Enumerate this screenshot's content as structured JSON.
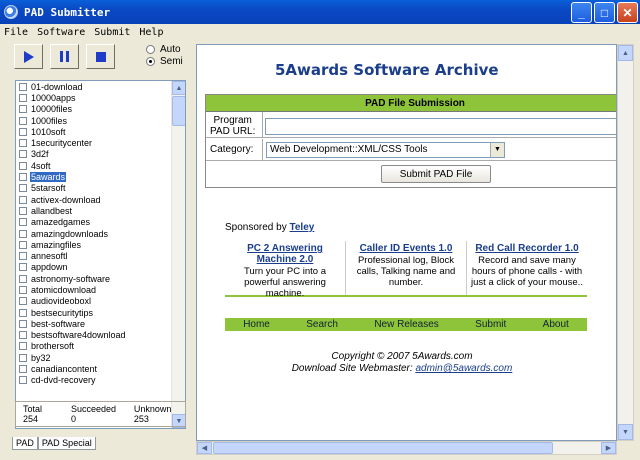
{
  "window": {
    "title": "PAD Submitter"
  },
  "menu": [
    "File",
    "Software",
    "Submit",
    "Help"
  ],
  "mode": {
    "auto_label": "Auto",
    "semi_label": "Semi",
    "selected": "Semi"
  },
  "sites": [
    "01-download",
    "10000apps",
    "10000files",
    "1000files",
    "1010soft",
    "1securitycenter",
    "3d2f",
    "4soft",
    "5awards",
    "5starsoft",
    "activex-download",
    "allandbest",
    "amazedgames",
    "amazingdownloads",
    "amazingfiles",
    "annesoftl",
    "appdown",
    "astronomy-software",
    "atomicdownload",
    "audiovideoboxl",
    "bestsecuritytips",
    "best-software",
    "bestsoftware4download",
    "brothersoft",
    "by32",
    "canadiancontent",
    "cd-dvd-recovery"
  ],
  "selected_site": "5awards",
  "status": {
    "total": "Total  254",
    "succeeded": "Succeeded  0",
    "unknown": "Unknown  253"
  },
  "tabs": [
    "PAD",
    "PAD Special"
  ],
  "web": {
    "site_title": "5Awards Software Archive",
    "form_header": "PAD File Submission",
    "url_label_1": "Program",
    "url_label_2": "PAD URL:",
    "url_value": "",
    "category_label": "Category:",
    "category_value": "Web Development::XML/CSS Tools",
    "submit_label": "Submit PAD File",
    "sponsored_prefix": "Sponsored by",
    "sponsor": "Teley",
    "ads": [
      {
        "title": "PC 2 Answering Machine 2.0",
        "body": "Turn your PC into a powerful answering machine."
      },
      {
        "title": "Caller ID Events 1.0",
        "body": "Professional log, Block calls, Talking name and number."
      },
      {
        "title": "Red Call Recorder 1.0",
        "body": "Record and save many hours of phone calls - with just a click of your mouse.."
      }
    ],
    "nav": [
      "Home",
      "Search",
      "New Releases",
      "Submit",
      "About"
    ],
    "copyright": "Copyright © 2007 5Awards.com",
    "webmaster_prefix": "Download Site Webmaster:",
    "webmaster_email": "admin@5awards.com"
  }
}
